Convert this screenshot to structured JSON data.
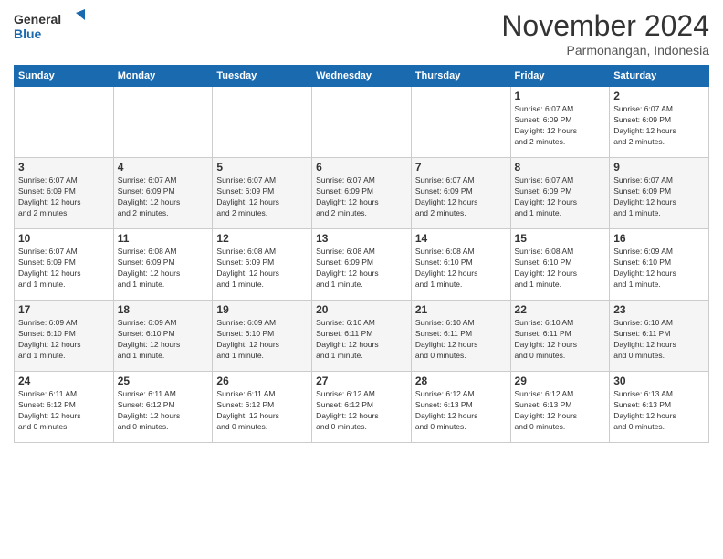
{
  "header": {
    "logo_line1": "General",
    "logo_line2": "Blue",
    "month_title": "November 2024",
    "location": "Parmonangan, Indonesia"
  },
  "weekdays": [
    "Sunday",
    "Monday",
    "Tuesday",
    "Wednesday",
    "Thursday",
    "Friday",
    "Saturday"
  ],
  "weeks": [
    [
      {
        "day": "",
        "info": ""
      },
      {
        "day": "",
        "info": ""
      },
      {
        "day": "",
        "info": ""
      },
      {
        "day": "",
        "info": ""
      },
      {
        "day": "",
        "info": ""
      },
      {
        "day": "1",
        "info": "Sunrise: 6:07 AM\nSunset: 6:09 PM\nDaylight: 12 hours\nand 2 minutes."
      },
      {
        "day": "2",
        "info": "Sunrise: 6:07 AM\nSunset: 6:09 PM\nDaylight: 12 hours\nand 2 minutes."
      }
    ],
    [
      {
        "day": "3",
        "info": "Sunrise: 6:07 AM\nSunset: 6:09 PM\nDaylight: 12 hours\nand 2 minutes."
      },
      {
        "day": "4",
        "info": "Sunrise: 6:07 AM\nSunset: 6:09 PM\nDaylight: 12 hours\nand 2 minutes."
      },
      {
        "day": "5",
        "info": "Sunrise: 6:07 AM\nSunset: 6:09 PM\nDaylight: 12 hours\nand 2 minutes."
      },
      {
        "day": "6",
        "info": "Sunrise: 6:07 AM\nSunset: 6:09 PM\nDaylight: 12 hours\nand 2 minutes."
      },
      {
        "day": "7",
        "info": "Sunrise: 6:07 AM\nSunset: 6:09 PM\nDaylight: 12 hours\nand 2 minutes."
      },
      {
        "day": "8",
        "info": "Sunrise: 6:07 AM\nSunset: 6:09 PM\nDaylight: 12 hours\nand 1 minute."
      },
      {
        "day": "9",
        "info": "Sunrise: 6:07 AM\nSunset: 6:09 PM\nDaylight: 12 hours\nand 1 minute."
      }
    ],
    [
      {
        "day": "10",
        "info": "Sunrise: 6:07 AM\nSunset: 6:09 PM\nDaylight: 12 hours\nand 1 minute."
      },
      {
        "day": "11",
        "info": "Sunrise: 6:08 AM\nSunset: 6:09 PM\nDaylight: 12 hours\nand 1 minute."
      },
      {
        "day": "12",
        "info": "Sunrise: 6:08 AM\nSunset: 6:09 PM\nDaylight: 12 hours\nand 1 minute."
      },
      {
        "day": "13",
        "info": "Sunrise: 6:08 AM\nSunset: 6:09 PM\nDaylight: 12 hours\nand 1 minute."
      },
      {
        "day": "14",
        "info": "Sunrise: 6:08 AM\nSunset: 6:10 PM\nDaylight: 12 hours\nand 1 minute."
      },
      {
        "day": "15",
        "info": "Sunrise: 6:08 AM\nSunset: 6:10 PM\nDaylight: 12 hours\nand 1 minute."
      },
      {
        "day": "16",
        "info": "Sunrise: 6:09 AM\nSunset: 6:10 PM\nDaylight: 12 hours\nand 1 minute."
      }
    ],
    [
      {
        "day": "17",
        "info": "Sunrise: 6:09 AM\nSunset: 6:10 PM\nDaylight: 12 hours\nand 1 minute."
      },
      {
        "day": "18",
        "info": "Sunrise: 6:09 AM\nSunset: 6:10 PM\nDaylight: 12 hours\nand 1 minute."
      },
      {
        "day": "19",
        "info": "Sunrise: 6:09 AM\nSunset: 6:10 PM\nDaylight: 12 hours\nand 1 minute."
      },
      {
        "day": "20",
        "info": "Sunrise: 6:10 AM\nSunset: 6:11 PM\nDaylight: 12 hours\nand 1 minute."
      },
      {
        "day": "21",
        "info": "Sunrise: 6:10 AM\nSunset: 6:11 PM\nDaylight: 12 hours\nand 0 minutes."
      },
      {
        "day": "22",
        "info": "Sunrise: 6:10 AM\nSunset: 6:11 PM\nDaylight: 12 hours\nand 0 minutes."
      },
      {
        "day": "23",
        "info": "Sunrise: 6:10 AM\nSunset: 6:11 PM\nDaylight: 12 hours\nand 0 minutes."
      }
    ],
    [
      {
        "day": "24",
        "info": "Sunrise: 6:11 AM\nSunset: 6:12 PM\nDaylight: 12 hours\nand 0 minutes."
      },
      {
        "day": "25",
        "info": "Sunrise: 6:11 AM\nSunset: 6:12 PM\nDaylight: 12 hours\nand 0 minutes."
      },
      {
        "day": "26",
        "info": "Sunrise: 6:11 AM\nSunset: 6:12 PM\nDaylight: 12 hours\nand 0 minutes."
      },
      {
        "day": "27",
        "info": "Sunrise: 6:12 AM\nSunset: 6:12 PM\nDaylight: 12 hours\nand 0 minutes."
      },
      {
        "day": "28",
        "info": "Sunrise: 6:12 AM\nSunset: 6:13 PM\nDaylight: 12 hours\nand 0 minutes."
      },
      {
        "day": "29",
        "info": "Sunrise: 6:12 AM\nSunset: 6:13 PM\nDaylight: 12 hours\nand 0 minutes."
      },
      {
        "day": "30",
        "info": "Sunrise: 6:13 AM\nSunset: 6:13 PM\nDaylight: 12 hours\nand 0 minutes."
      }
    ]
  ]
}
